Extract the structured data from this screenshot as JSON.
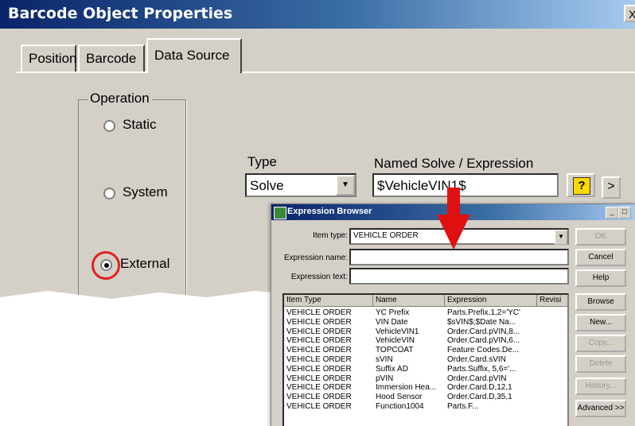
{
  "window": {
    "title": "Barcode Object Properties",
    "close_glyph": "X"
  },
  "tabs": [
    {
      "label": "Position"
    },
    {
      "label": "Barcode"
    },
    {
      "label": "Data Source",
      "active": true
    }
  ],
  "operation": {
    "legend": "Operation",
    "options": [
      {
        "label": "Static",
        "selected": false
      },
      {
        "label": "System",
        "selected": false
      },
      {
        "label": "External",
        "selected": true
      }
    ]
  },
  "type_field": {
    "label": "Type",
    "value": "Solve"
  },
  "expression_field": {
    "label": "Named Solve / Expression",
    "value": "$VehicleVIN1$"
  },
  "more_button": {
    "label": ">"
  },
  "expression_browser": {
    "title": "Expression Browser",
    "item_type_label": "Item type:",
    "item_type_value": "VEHICLE ORDER",
    "expression_name_label": "Expression name:",
    "expression_name_value": "",
    "expression_text_label": "Expression text:",
    "expression_text_value": "",
    "buttons": [
      {
        "label": "OK",
        "enabled": false
      },
      {
        "label": "Cancel",
        "enabled": true
      },
      {
        "label": "Help",
        "enabled": true
      },
      {
        "label": "Browse",
        "enabled": true
      },
      {
        "label": "New...",
        "enabled": true
      },
      {
        "label": "Copy...",
        "enabled": false
      },
      {
        "label": "Delete",
        "enabled": false
      },
      {
        "label": "History...",
        "enabled": false
      },
      {
        "label": "Advanced >>",
        "enabled": true
      }
    ],
    "columns": [
      "Item Type",
      "Name",
      "Expression",
      "Revisi"
    ],
    "rows": [
      [
        "VEHICLE ORDER",
        "YC Prefix",
        "Parts.Prefix,1,2='YC'",
        ""
      ],
      [
        "VEHICLE ORDER",
        "VIN Date",
        "$sVIN$;$Date Na...",
        ""
      ],
      [
        "VEHICLE ORDER",
        "VehicleVIN1",
        "Order.Card.pVIN,8...",
        ""
      ],
      [
        "VEHICLE ORDER",
        "VehicleVIN",
        "Order.Card.pVIN,6...",
        ""
      ],
      [
        "VEHICLE ORDER",
        "TOPCOAT",
        "Feature Codes.De...",
        ""
      ],
      [
        "VEHICLE ORDER",
        "sVIN",
        "Order.Card.sVIN",
        ""
      ],
      [
        "VEHICLE ORDER",
        "Suffix AD",
        "Parts.Suffix, 5,6='...",
        ""
      ],
      [
        "VEHICLE ORDER",
        "pVIN",
        "Order.Card.pVIN",
        ""
      ],
      [
        "VEHICLE ORDER",
        "Immersion Hea...",
        "Order.Card.D,12,1",
        ""
      ],
      [
        "VEHICLE ORDER",
        "Hood Sensor",
        "Order.Card.D,35,1",
        ""
      ],
      [
        "VEHICLE ORDER",
        "Function1004",
        "Parts.F...",
        ""
      ]
    ]
  },
  "annotations": {
    "arrow_color": "#e01010",
    "highlight_color": "#e02020"
  },
  "icons": {
    "help": "help-question-icon",
    "expression_browser": "app-icon"
  }
}
